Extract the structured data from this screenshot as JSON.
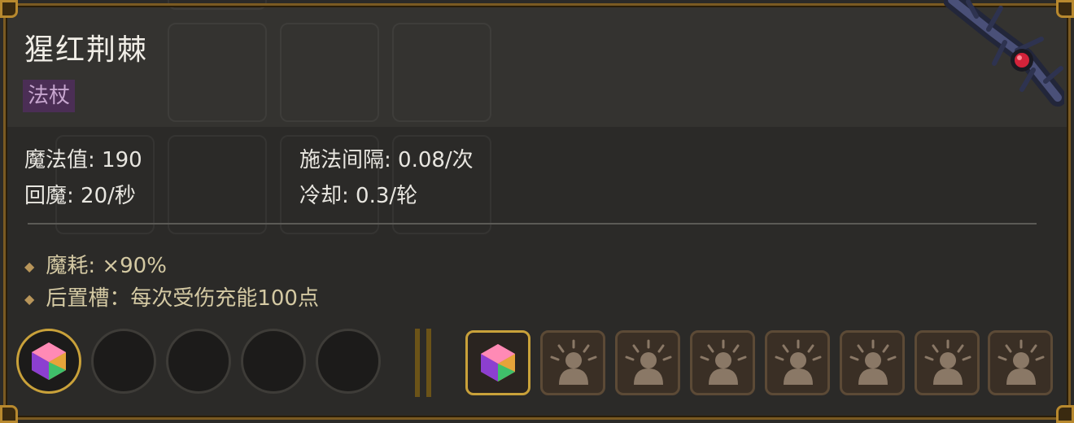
{
  "item": {
    "name": "猩红荆棘",
    "type": "法杖",
    "name_color": "#f0ede6",
    "type_bg_color": "#4b2e55"
  },
  "stats": {
    "mana_label": "魔法值: 190",
    "regen_label": "回魔: 20/秒",
    "cast_interval_label": "施法间隔: 0.08/次",
    "cooldown_label": "冷却: 0.3/轮"
  },
  "effects": [
    "魔耗: ×90%",
    "后置槽：每次受伤充能100点"
  ],
  "slots": {
    "round_slots": [
      {
        "filled": true,
        "icon": "gem-icon"
      },
      {
        "filled": false
      },
      {
        "filled": false
      },
      {
        "filled": false
      },
      {
        "filled": false
      }
    ],
    "square_slots": [
      {
        "state": "filled",
        "icon": "gem-icon"
      },
      {
        "state": "locked",
        "icon": "locked-slot-icon"
      },
      {
        "state": "locked",
        "icon": "locked-slot-icon"
      },
      {
        "state": "locked",
        "icon": "locked-slot-icon"
      },
      {
        "state": "locked",
        "icon": "locked-slot-icon"
      },
      {
        "state": "locked",
        "icon": "locked-slot-icon"
      },
      {
        "state": "locked",
        "icon": "locked-slot-icon"
      },
      {
        "state": "locked",
        "icon": "locked-slot-icon"
      }
    ]
  },
  "colors": {
    "frame_gold": "#c9a13a",
    "effect_text": "#d4c9a3"
  }
}
